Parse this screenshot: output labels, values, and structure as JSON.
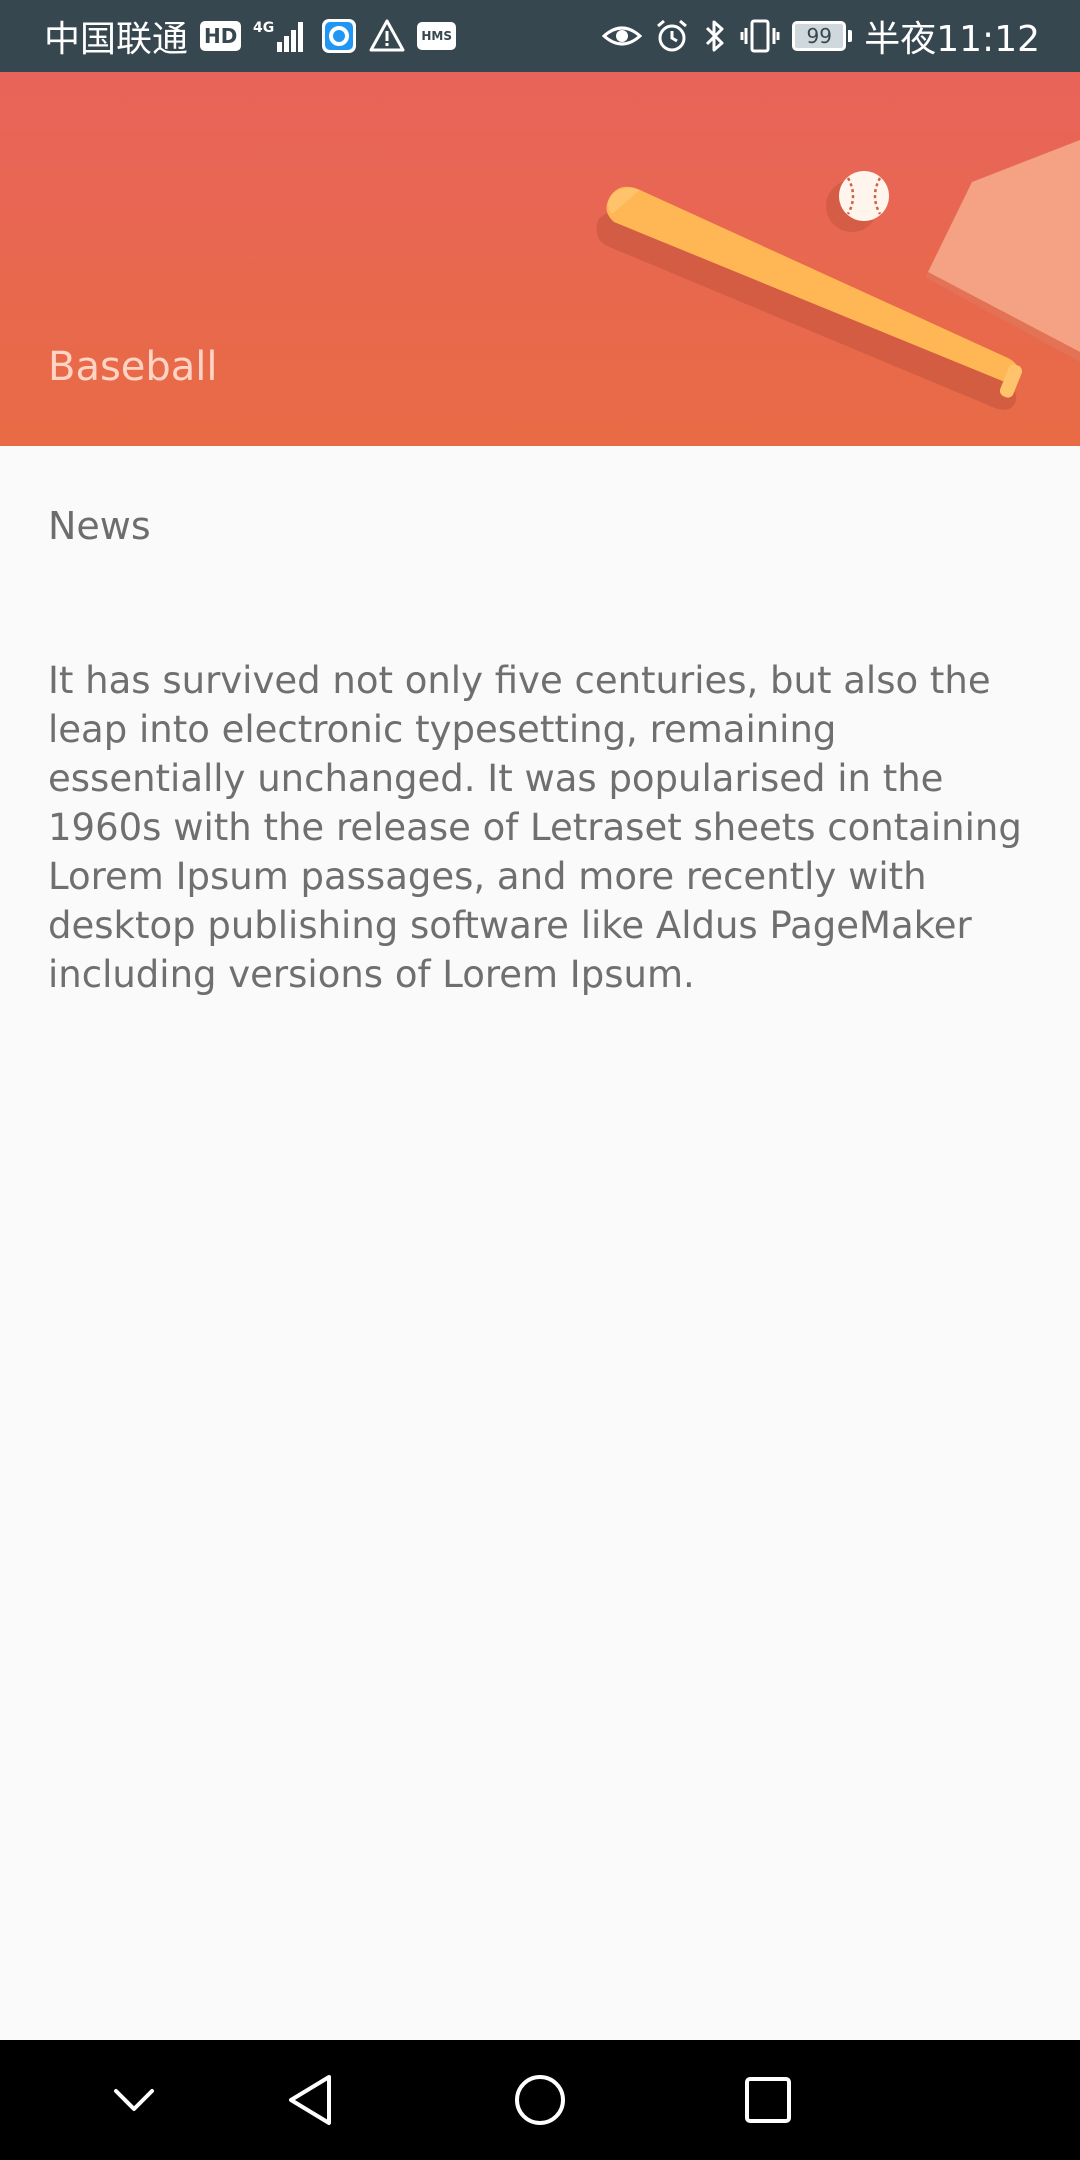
{
  "status_bar": {
    "carrier": "中国联通",
    "hd_badge": "HD",
    "network": "4G",
    "hms_badge": "HMS",
    "battery_level": "99",
    "time": "半夜11:12",
    "icons": [
      "hd-icon",
      "signal-icon",
      "app-notification-icon",
      "warning-icon",
      "hms-icon",
      "eye-icon",
      "alarm-icon",
      "bluetooth-icon",
      "vibrate-icon",
      "battery-icon"
    ]
  },
  "header": {
    "title": "Baseball",
    "gradient_colors": [
      "#e8645a",
      "#e86b45"
    ],
    "illustration": "baseball-bat-and-ball-illustration"
  },
  "content": {
    "section_title": "News",
    "body": "It has survived not only five centuries, but also the leap into electronic typesetting, remaining essentially unchanged. It was popularised in the 1960s with the release of Letraset sheets containing Lorem Ipsum passages, and more recently with desktop publishing software like Aldus PageMaker including versions of Lorem Ipsum."
  },
  "nav_bar": {
    "buttons": [
      "chevron-down-icon",
      "back-icon",
      "home-icon",
      "recents-icon"
    ]
  },
  "colors": {
    "status_bar": "#37474f",
    "header_title": "#ffd4c4",
    "background": "#fafafa",
    "text": "#6f6f6f",
    "nav_bar": "#000000"
  }
}
